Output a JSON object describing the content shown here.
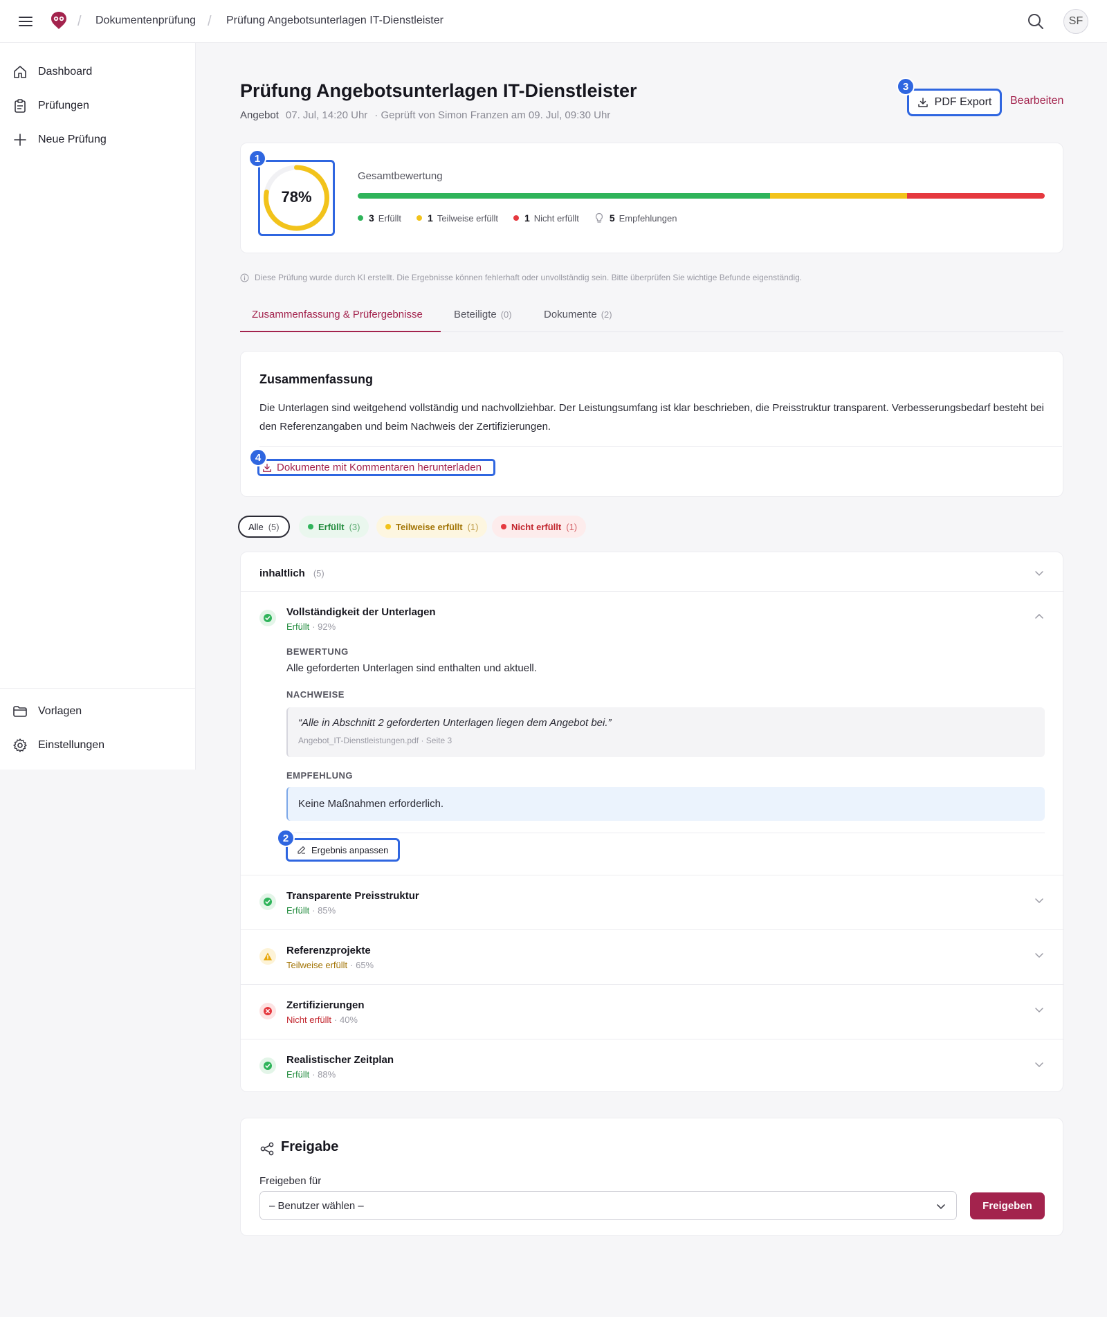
{
  "header": {
    "breadcrumb": [
      "Dokumentenprüfung",
      "Prüfung Angebotsunterlagen IT-Dienstleister"
    ],
    "avatar_initials": "SF",
    "icons": [
      "menu-icon",
      "logo-icon",
      "search-icon"
    ]
  },
  "sidebar": {
    "items": [
      {
        "label": "Dashboard",
        "icon": "home-icon"
      },
      {
        "label": "Prüfungen",
        "icon": "clipboard-icon"
      },
      {
        "label": "Neue Prüfung",
        "icon": "plus-icon"
      }
    ],
    "bottom_items": [
      {
        "label": "Vorlagen",
        "icon": "folder-icon"
      },
      {
        "label": "Einstellungen",
        "icon": "gear-icon"
      }
    ]
  },
  "page": {
    "title": "Prüfung Angebotsunterlagen IT-Dienstleister",
    "type": "Angebot",
    "date": "07. Jul, 14:20 Uhr",
    "reviewed": "· Geprüft von Simon Franzen am 09. Jul, 09:30 Uhr",
    "export_label": "PDF Export",
    "edit_label": "Bearbeiten"
  },
  "annotations": [
    "1",
    "2",
    "3",
    "4"
  ],
  "score": {
    "percent": 78,
    "percent_label": "78%",
    "title": "Gesamtbewertung",
    "bar": [
      {
        "key": "erfuellt",
        "fraction": 0.6,
        "color": "#2fb45a"
      },
      {
        "key": "teilweise",
        "fraction": 0.2,
        "color": "#f2c31b"
      },
      {
        "key": "nicht",
        "fraction": 0.2,
        "color": "#e5393f"
      }
    ],
    "legend": [
      {
        "count": "3",
        "label": "Erfüllt",
        "color": "#2fb45a"
      },
      {
        "count": "1",
        "label": "Teilweise erfüllt",
        "color": "#f2c31b"
      },
      {
        "count": "1",
        "label": "Nicht erfüllt",
        "color": "#e5393f"
      }
    ],
    "recommendations": {
      "count": "5",
      "label": "Empfehlungen"
    }
  },
  "disclaimer": "Diese Prüfung wurde durch KI erstellt. Die Ergebnisse können fehlerhaft oder unvollständig sein. Bitte überprüfen Sie wichtige Befunde eigenständig.",
  "tabs": [
    {
      "label": "Zusammenfassung & Prüfergebnisse",
      "count": "",
      "active": true
    },
    {
      "label": "Beteiligte",
      "count": "(0)"
    },
    {
      "label": "Dokumente",
      "count": "(2)"
    }
  ],
  "summary": {
    "title": "Zusammenfassung",
    "text": "Die Unterlagen sind weitgehend vollständig und nachvollziehbar. Der Leistungsumfang ist klar beschrieben, die Preisstruktur transparent. Verbesserungsbedarf besteht bei den Referenzangaben und beim Nachweis der Zertifizierungen.",
    "download_label": "Dokumente mit Kommentaren herunterladen"
  },
  "filters": [
    {
      "label": "Alle",
      "count": "(5)"
    },
    {
      "label": "Erfüllt",
      "count": "(3)"
    },
    {
      "label": "Teilweise erfüllt",
      "count": "(1)"
    },
    {
      "label": "Nicht erfüllt",
      "count": "(1)"
    }
  ],
  "group": {
    "label": "inhaltlich",
    "count": "(5)"
  },
  "criteria": [
    {
      "title": "Vollständigkeit der Unterlagen",
      "status": "Erfüllt",
      "percent": "· 92%",
      "state": "ok",
      "bewertung_label": "BEWERTUNG",
      "bewertung": "Alle geforderten Unterlagen sind enthalten und aktuell.",
      "nachweise_label": "NACHWEISE",
      "quote": "“Alle in Abschnitt 2 geforderten Unterlagen liegen dem Angebot bei.”",
      "source": "Angebot_IT-Dienstleistungen.pdf · Seite 3",
      "empfehlung_label": "EMPFEHLUNG",
      "empfehlung": "Keine Maßnahmen erforderlich.",
      "adjust_label": "Ergebnis anpassen"
    },
    {
      "title": "Transparente Preisstruktur",
      "status": "Erfüllt",
      "percent": "· 85%",
      "state": "ok"
    },
    {
      "title": "Referenzprojekte",
      "status": "Teilweise erfüllt",
      "percent": "· 65%",
      "state": "partial"
    },
    {
      "title": "Zertifizierungen",
      "status": "Nicht erfüllt",
      "percent": "· 40%",
      "state": "fail"
    },
    {
      "title": "Realistischer Zeitplan",
      "status": "Erfüllt",
      "percent": "· 88%",
      "state": "ok"
    }
  ],
  "freigabe": {
    "title": "Freigabe",
    "label": "Freigeben für",
    "select_value": "– Benutzer wählen –",
    "button": "Freigeben"
  },
  "colors": {
    "accent": "#a3234d",
    "highlight": "#2f66e0",
    "ok": "#1f8a3b",
    "partial": "#a27405",
    "fail": "#c2262e"
  }
}
